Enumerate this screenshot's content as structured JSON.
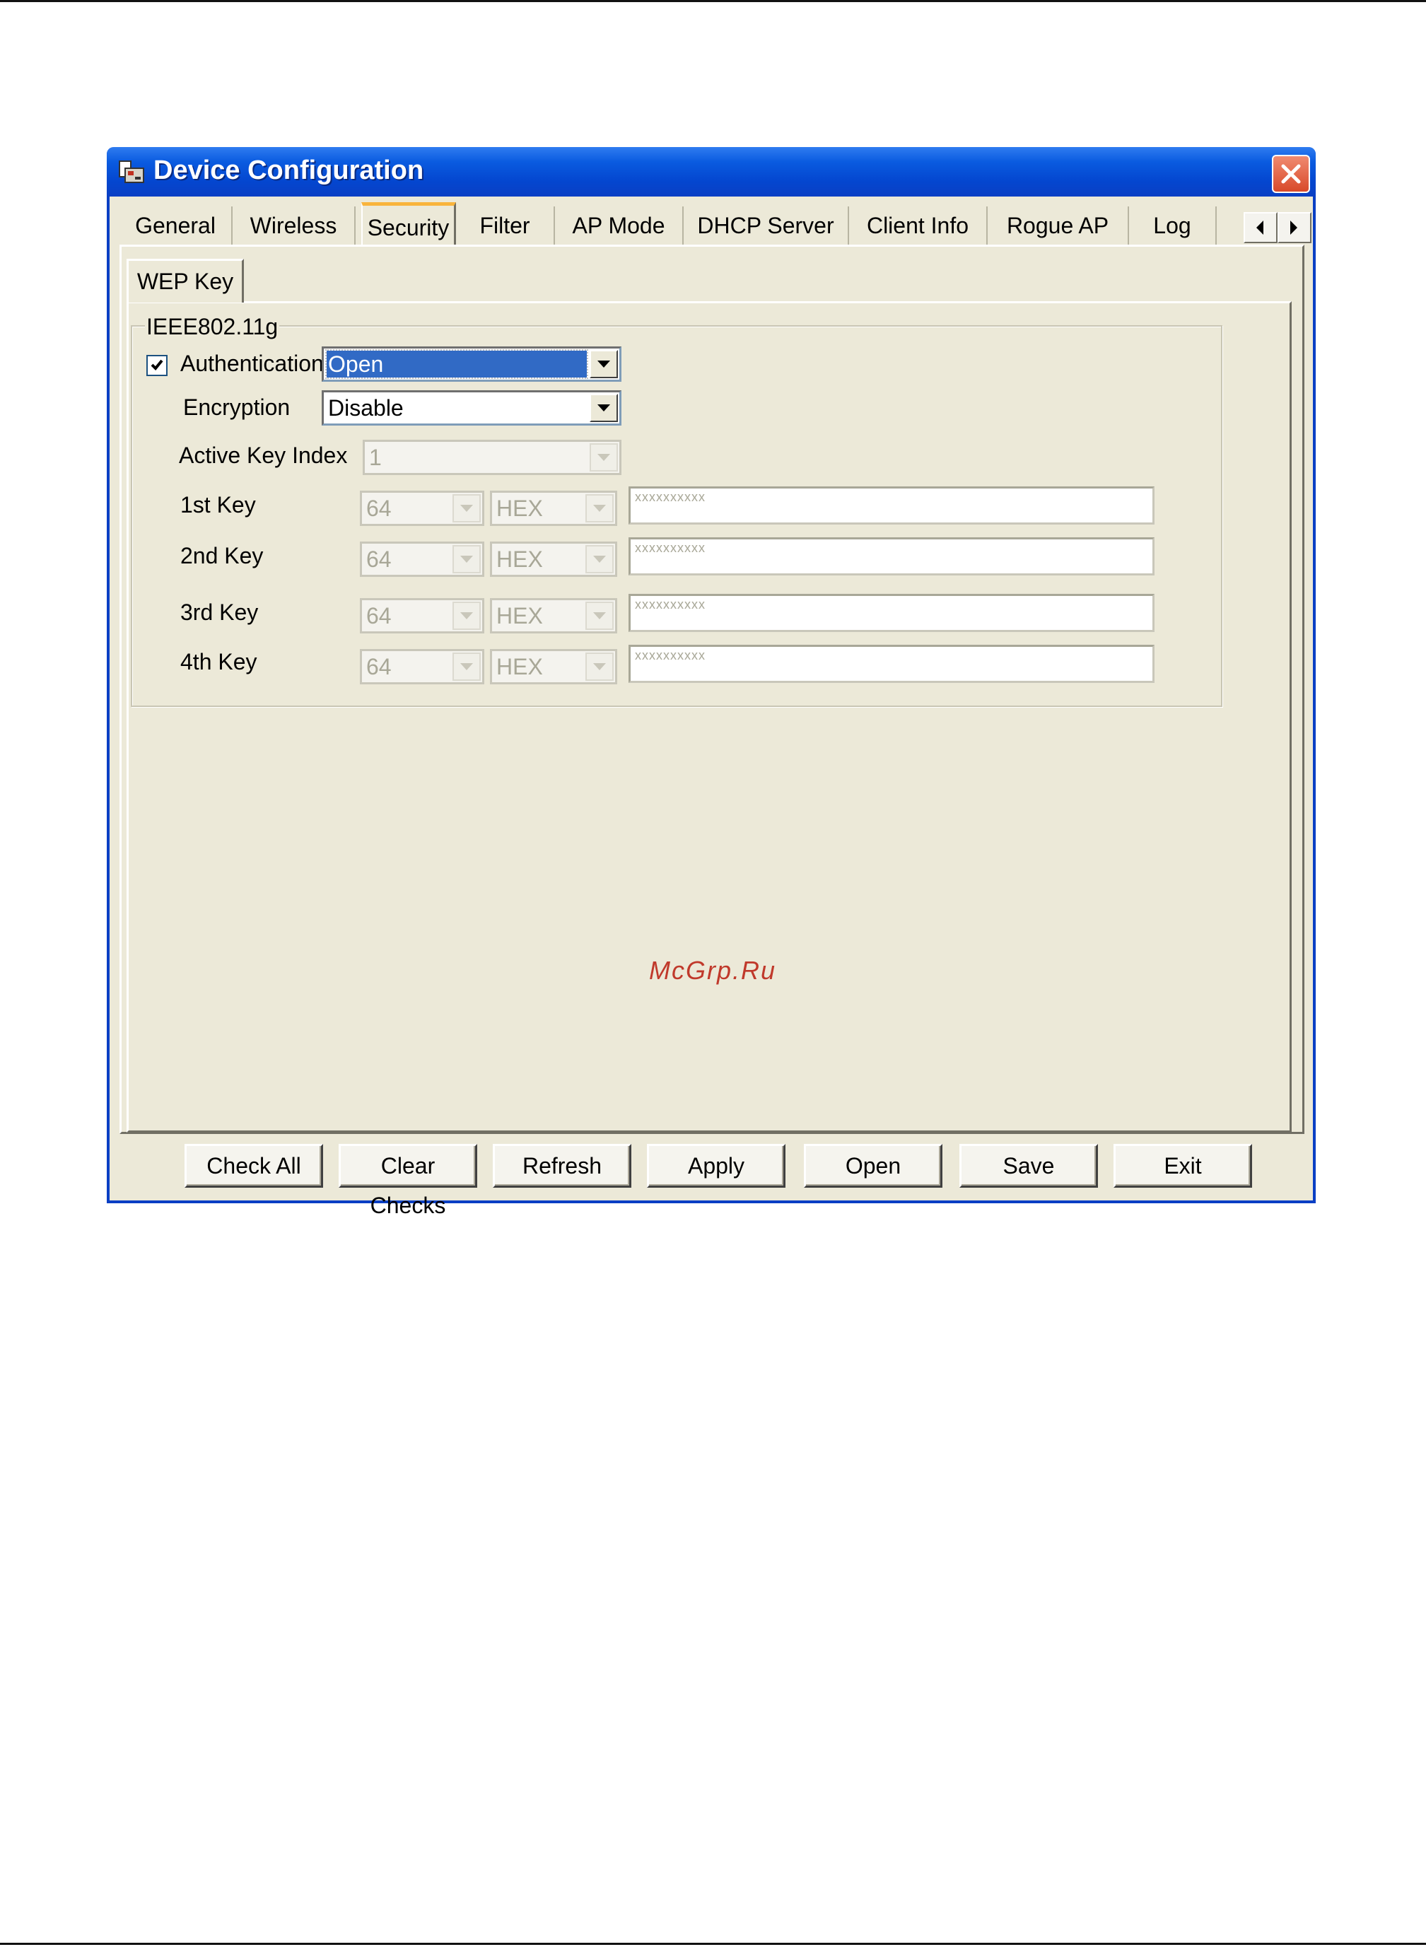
{
  "window": {
    "title": "Device Configuration"
  },
  "tabs": [
    {
      "label": "General"
    },
    {
      "label": "Wireless"
    },
    {
      "label": "Security"
    },
    {
      "label": "Filter"
    },
    {
      "label": "AP Mode"
    },
    {
      "label": "DHCP Server"
    },
    {
      "label": "Client Info"
    },
    {
      "label": "Rogue AP"
    },
    {
      "label": "Log"
    }
  ],
  "active_tab": "Security",
  "subtab": {
    "label": "WEP Key"
  },
  "group": {
    "title": "IEEE802.11g",
    "authentication": {
      "label": "Authentication",
      "checked": true,
      "value": "Open"
    },
    "encryption": {
      "label": "Encryption",
      "value": "Disable"
    },
    "active_key_index": {
      "label": "Active Key Index",
      "value": "1"
    },
    "keys": [
      {
        "label": "1st Key",
        "length": "64",
        "format": "HEX",
        "value": "xxxxxxxxxx"
      },
      {
        "label": "2nd Key",
        "length": "64",
        "format": "HEX",
        "value": "xxxxxxxxxx"
      },
      {
        "label": "3rd Key",
        "length": "64",
        "format": "HEX",
        "value": "xxxxxxxxxx"
      },
      {
        "label": "4th Key",
        "length": "64",
        "format": "HEX",
        "value": "xxxxxxxxxx"
      }
    ]
  },
  "watermark": "McGrp.Ru",
  "buttons": {
    "check_all": "Check All",
    "clear_checks": "Clear Checks",
    "refresh": "Refresh",
    "apply": "Apply",
    "open": "Open",
    "save": "Save",
    "exit": "Exit"
  }
}
